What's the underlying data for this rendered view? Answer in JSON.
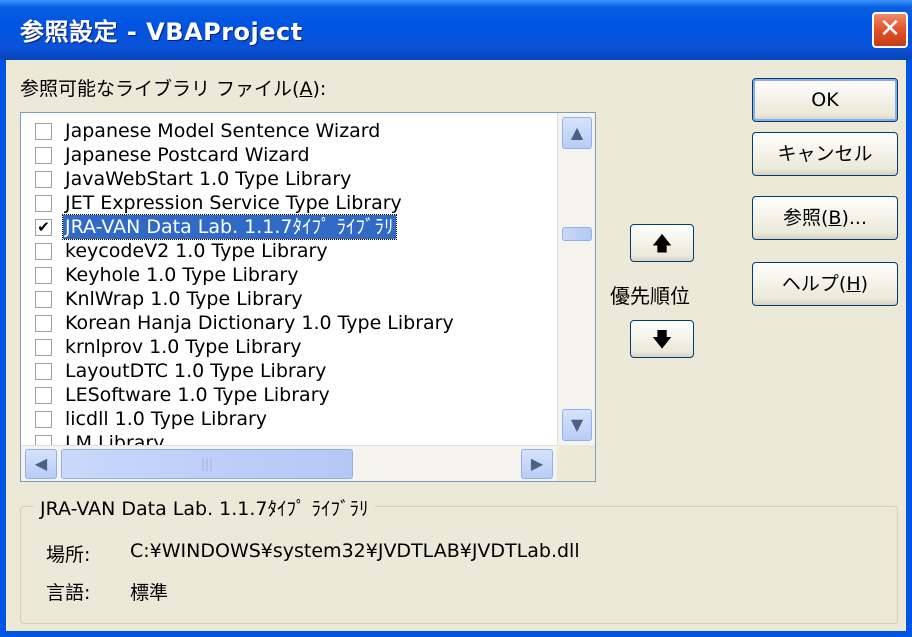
{
  "window": {
    "title": "参照設定 - VBAProject",
    "close_glyph": "✕"
  },
  "list_label": {
    "before": "参照可能なライブラリ ファイル(",
    "key": "A",
    "after": "):"
  },
  "items": [
    {
      "label": "Japanese Model Sentence Wizard",
      "checked": false,
      "selected": false
    },
    {
      "label": "Japanese Postcard Wizard",
      "checked": false,
      "selected": false
    },
    {
      "label": "JavaWebStart 1.0 Type Library",
      "checked": false,
      "selected": false
    },
    {
      "label": "JET Expression Service Type Library",
      "checked": false,
      "selected": false
    },
    {
      "label": "JRA-VAN Data Lab. 1.1.7ﾀｲﾌﾟ ﾗｲﾌﾞﾗﾘ",
      "checked": true,
      "selected": true
    },
    {
      "label": "keycodeV2 1.0 Type Library",
      "checked": false,
      "selected": false
    },
    {
      "label": "Keyhole 1.0 Type Library",
      "checked": false,
      "selected": false
    },
    {
      "label": "KnlWrap 1.0 Type Library",
      "checked": false,
      "selected": false
    },
    {
      "label": "Korean Hanja Dictionary 1.0 Type Library",
      "checked": false,
      "selected": false
    },
    {
      "label": "krnlprov 1.0 Type Library",
      "checked": false,
      "selected": false
    },
    {
      "label": "LayoutDTC 1.0 Type Library",
      "checked": false,
      "selected": false
    },
    {
      "label": "LESoftware 1.0 Type Library",
      "checked": false,
      "selected": false
    },
    {
      "label": "licdll 1.0 Type Library",
      "checked": false,
      "selected": false
    },
    {
      "label": "LM Library",
      "checked": false,
      "selected": false
    }
  ],
  "checkmark": "✔",
  "scroll": {
    "up": "▲",
    "down": "▼",
    "left": "◀",
    "right": "▶",
    "grip": "|||",
    "grip_v": "═"
  },
  "buttons": {
    "ok": "OK",
    "cancel": "キャンセル",
    "browse": {
      "before": "参照(",
      "key": "B",
      "after": ")..."
    },
    "help": {
      "before": "ヘルプ(",
      "key": "H",
      "after": ")"
    }
  },
  "priority": {
    "label": "優先順位",
    "up": "🡅",
    "down": "🡇"
  },
  "details": {
    "group_title": "JRA-VAN Data Lab. 1.1.7ﾀｲﾌﾟ ﾗｲﾌﾞﾗﾘ",
    "location_label": "場所:",
    "location_value": "C:¥WINDOWS¥system32¥JVDTLAB¥JVDTLab.dll",
    "language_label": "言語:",
    "language_value": "標準"
  }
}
